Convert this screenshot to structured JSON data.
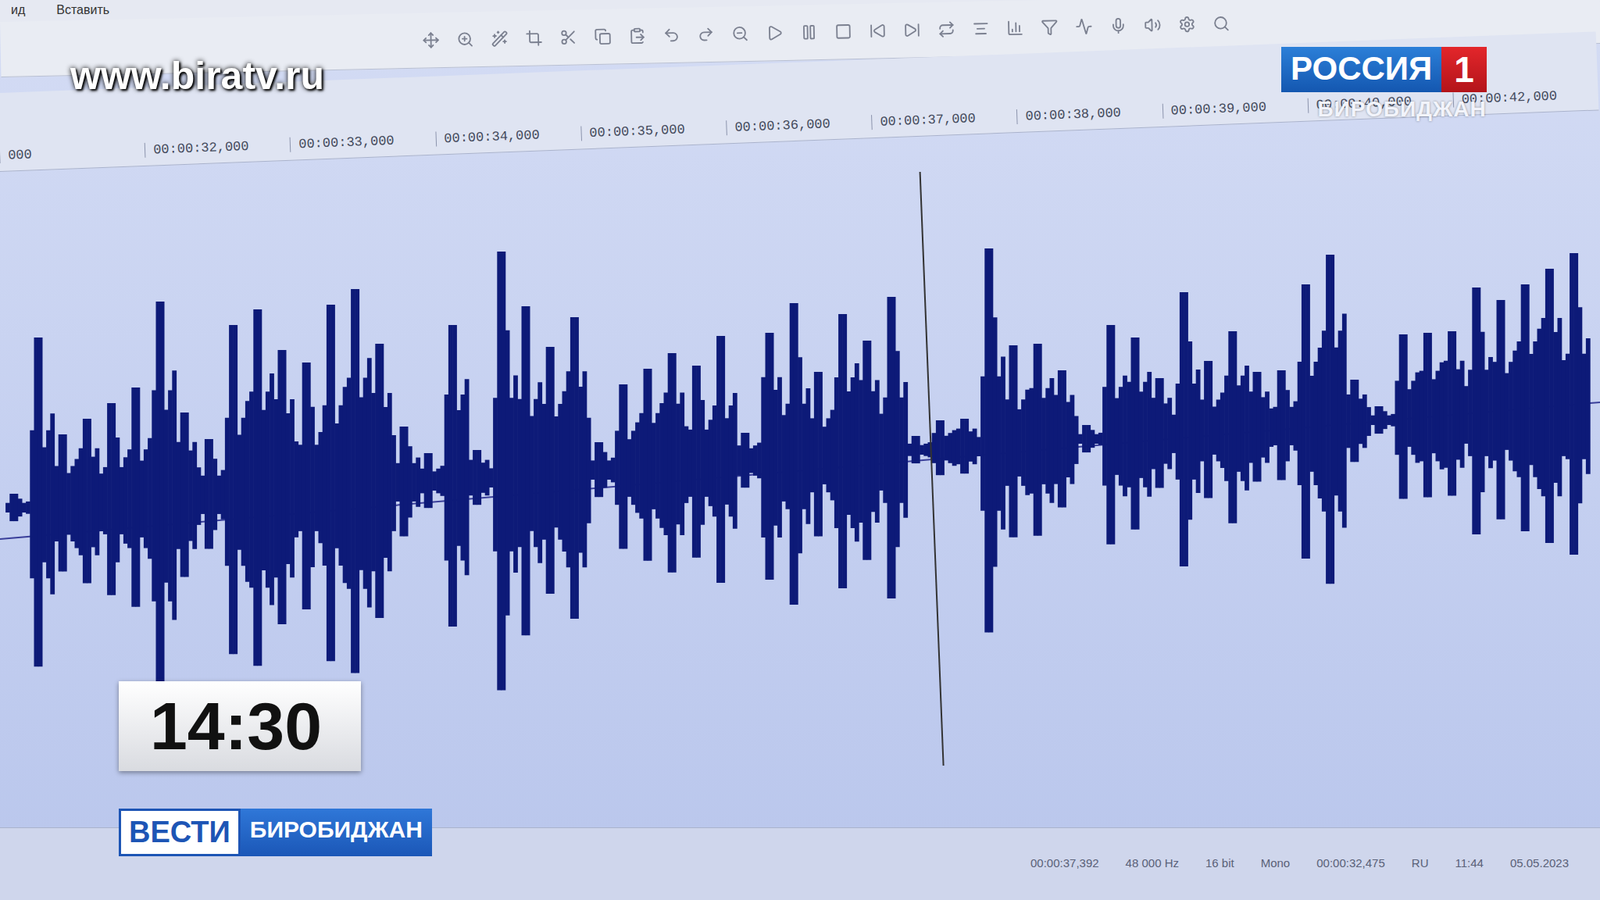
{
  "overlays": {
    "site": "www.biratv.ru",
    "channel": {
      "name": "РОССИЯ",
      "number": "1",
      "city": "БИРОБИДЖАН"
    },
    "clock": "14:30",
    "program": {
      "name": "ВЕСТИ",
      "city": "БИРОБИДЖАН"
    }
  },
  "editor": {
    "menu": [
      "ид",
      "Вставить"
    ],
    "ruler": [
      "000",
      "00:00:32,000",
      "00:00:33,000",
      "00:00:34,000",
      "00:00:35,000",
      "00:00:36,000",
      "00:00:37,000",
      "00:00:38,000",
      "00:00:39,000",
      "00:00:40,000",
      "00:00:42,000"
    ],
    "waveform": {
      "peaks": [
        0.05,
        0.6,
        0.25,
        0.3,
        0.35,
        0.4,
        0.7,
        0.3,
        0.2,
        0.6,
        0.65,
        0.5,
        0.45,
        0.65,
        0.7,
        0.5,
        0.2,
        0.1,
        0.55,
        0.1,
        0.8,
        0.6,
        0.45,
        0.55,
        0.1,
        0.3,
        0.35,
        0.4,
        0.35,
        0.45,
        0.1,
        0.45,
        0.55,
        0.3,
        0.5,
        0.4,
        0.55,
        0.05,
        0.1,
        0.1,
        0.7,
        0.35,
        0.35,
        0.25,
        0.05,
        0.4,
        0.35,
        0.2,
        0.5,
        0.25,
        0.35,
        0.2,
        0.2,
        0.5,
        0.6,
        0.15,
        0.05,
        0.3,
        0.3,
        0.3,
        0.45,
        0.4,
        0.45,
        0.5,
        0.55
      ],
      "cursor": 0.575
    },
    "status": [
      "00:00:37,392",
      "48 000 Hz",
      "16 bit",
      "Mono",
      "00:00:32,475",
      "RU",
      "11:44",
      "05.05.2023"
    ]
  }
}
